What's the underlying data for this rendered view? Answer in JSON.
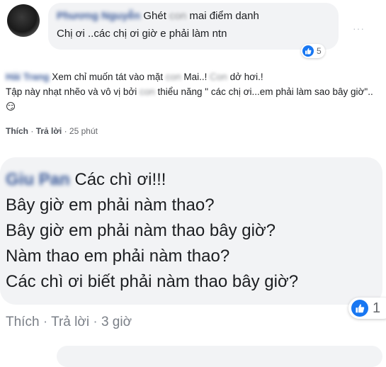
{
  "comments": [
    {
      "author": "Phương Nguyễn",
      "lines": [
        {
          "parts": [
            "Ghét ",
            "con",
            " mai điểm danh"
          ]
        },
        {
          "parts": [
            "Chị ơi ..các chị ơi giờ e phải làm ntn"
          ]
        }
      ],
      "reaction_count": "5",
      "more": "···"
    },
    {
      "author": "Hải Trang",
      "text_parts": [
        " Xem chỉ muốn tát vào mặt ",
        "con",
        " Mai..! ",
        "Con",
        " dở hơi.!",
        " Tập này nhạt nhẽo và vô vị bởi ",
        "con",
        " thiểu năng \" các chị ơi...em phải làm sao bây giờ\".. ",
        "😏"
      ],
      "actions": {
        "like": "Thích",
        "reply": "Trả lời",
        "time": "25 phút"
      }
    },
    {
      "author": "Giu Pan",
      "lines": [
        "Các chì ơi!!!",
        "Bây giờ em phải nàm thao?",
        "Bây giờ em phải nàm thao bây giờ?",
        "Nàm thao em phải nàm thao?",
        "Các chì ơi biết phải nàm thao bây giờ?"
      ],
      "reaction_count": "1",
      "actions": {
        "like": "Thích",
        "reply": "Trả lời",
        "time": "3 giờ"
      }
    }
  ],
  "colors": {
    "bubble": "#f2f3f5",
    "link": "#385898",
    "like_blue": "#1877f2",
    "meta": "#65676b"
  },
  "icons": [
    "more-icon",
    "like-icon"
  ]
}
